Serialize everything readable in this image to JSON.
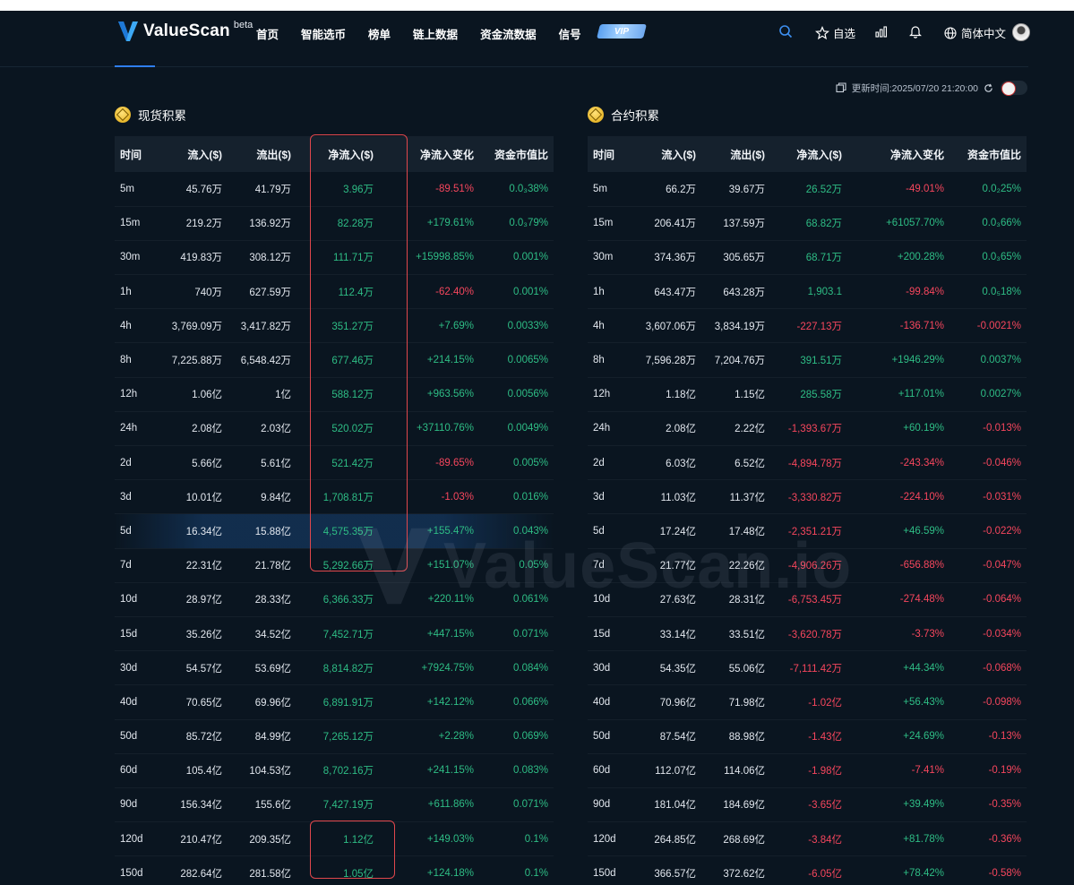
{
  "nav": {
    "logo_text": "ValueScan",
    "logo_beta": "beta",
    "links": [
      "首页",
      "智能选币",
      "榜单",
      "链上数据",
      "资金流数据",
      "信号"
    ],
    "vip_label": "VIP",
    "watchlist_label": "自选",
    "language_label": "简体中文"
  },
  "update_text": "更新时间:2025/07/20 21:20:00",
  "watermark_text": "ValueScan.io",
  "spot": {
    "title": "现货积累",
    "headers": [
      "时间",
      "流入($)",
      "流出($)",
      "净流入($)",
      "净流入变化",
      "资金市值比"
    ],
    "rows": [
      [
        "5m",
        "45.76万",
        "41.79万",
        "3.96万",
        "-89.51%",
        "0.0₃38%"
      ],
      [
        "15m",
        "219.2万",
        "136.92万",
        "82.28万",
        "+179.61%",
        "0.0₃79%"
      ],
      [
        "30m",
        "419.83万",
        "308.12万",
        "111.71万",
        "+15998.85%",
        "0.001%"
      ],
      [
        "1h",
        "740万",
        "627.59万",
        "112.4万",
        "-62.40%",
        "0.001%"
      ],
      [
        "4h",
        "3,769.09万",
        "3,417.82万",
        "351.27万",
        "+7.69%",
        "0.0033%"
      ],
      [
        "8h",
        "7,225.88万",
        "6,548.42万",
        "677.46万",
        "+214.15%",
        "0.0065%"
      ],
      [
        "12h",
        "1.06亿",
        "1亿",
        "588.12万",
        "+963.56%",
        "0.0056%"
      ],
      [
        "24h",
        "2.08亿",
        "2.03亿",
        "520.02万",
        "+37110.76%",
        "0.0049%"
      ],
      [
        "2d",
        "5.66亿",
        "5.61亿",
        "521.42万",
        "-89.65%",
        "0.005%"
      ],
      [
        "3d",
        "10.01亿",
        "9.84亿",
        "1,708.81万",
        "-1.03%",
        "0.016%"
      ],
      [
        "5d",
        "16.34亿",
        "15.88亿",
        "4,575.35万",
        "+155.47%",
        "0.043%"
      ],
      [
        "7d",
        "22.31亿",
        "21.78亿",
        "5,292.66万",
        "+151.07%",
        "0.05%"
      ],
      [
        "10d",
        "28.97亿",
        "28.33亿",
        "6,366.33万",
        "+220.11%",
        "0.061%"
      ],
      [
        "15d",
        "35.26亿",
        "34.52亿",
        "7,452.71万",
        "+447.15%",
        "0.071%"
      ],
      [
        "30d",
        "54.57亿",
        "53.69亿",
        "8,814.82万",
        "+7924.75%",
        "0.084%"
      ],
      [
        "40d",
        "70.65亿",
        "69.96亿",
        "6,891.91万",
        "+142.12%",
        "0.066%"
      ],
      [
        "50d",
        "85.72亿",
        "84.99亿",
        "7,265.12万",
        "+2.28%",
        "0.069%"
      ],
      [
        "60d",
        "105.4亿",
        "104.53亿",
        "8,702.16万",
        "+241.15%",
        "0.083%"
      ],
      [
        "90d",
        "156.34亿",
        "155.6亿",
        "7,427.19万",
        "+611.86%",
        "0.071%"
      ],
      [
        "120d",
        "210.47亿",
        "209.35亿",
        "1.12亿",
        "+149.03%",
        "0.1%"
      ],
      [
        "150d",
        "282.64亿",
        "281.58亿",
        "1.05亿",
        "+124.18%",
        "0.1%"
      ]
    ]
  },
  "futures": {
    "title": "合约积累",
    "headers": [
      "时间",
      "流入($)",
      "流出($)",
      "净流入($)",
      "净流入变化",
      "资金市值比"
    ],
    "rows": [
      [
        "5m",
        "66.2万",
        "39.67万",
        "26.52万",
        "-49.01%",
        "0.0₂25%"
      ],
      [
        "15m",
        "206.41万",
        "137.59万",
        "68.82万",
        "+61057.70%",
        "0.0₃66%"
      ],
      [
        "30m",
        "374.36万",
        "305.65万",
        "68.71万",
        "+200.28%",
        "0.0₃65%"
      ],
      [
        "1h",
        "643.47万",
        "643.28万",
        "1,903.1",
        "-99.84%",
        "0.0₅18%"
      ],
      [
        "4h",
        "3,607.06万",
        "3,834.19万",
        "-227.13万",
        "-136.71%",
        "-0.0021%"
      ],
      [
        "8h",
        "7,596.28万",
        "7,204.76万",
        "391.51万",
        "+1946.29%",
        "0.0037%"
      ],
      [
        "12h",
        "1.18亿",
        "1.15亿",
        "285.58万",
        "+117.01%",
        "0.0027%"
      ],
      [
        "24h",
        "2.08亿",
        "2.22亿",
        "-1,393.67万",
        "+60.19%",
        "-0.013%"
      ],
      [
        "2d",
        "6.03亿",
        "6.52亿",
        "-4,894.78万",
        "-243.34%",
        "-0.046%"
      ],
      [
        "3d",
        "11.03亿",
        "11.37亿",
        "-3,330.82万",
        "-224.10%",
        "-0.031%"
      ],
      [
        "5d",
        "17.24亿",
        "17.48亿",
        "-2,351.21万",
        "+46.59%",
        "-0.022%"
      ],
      [
        "7d",
        "21.77亿",
        "22.26亿",
        "-4,906.26万",
        "-656.88%",
        "-0.047%"
      ],
      [
        "10d",
        "27.63亿",
        "28.31亿",
        "-6,753.45万",
        "-274.48%",
        "-0.064%"
      ],
      [
        "15d",
        "33.14亿",
        "33.51亿",
        "-3,620.78万",
        "-3.73%",
        "-0.034%"
      ],
      [
        "30d",
        "54.35亿",
        "55.06亿",
        "-7,111.42万",
        "+44.34%",
        "-0.068%"
      ],
      [
        "40d",
        "70.96亿",
        "71.98亿",
        "-1.02亿",
        "+56.43%",
        "-0.098%"
      ],
      [
        "50d",
        "87.54亿",
        "88.98亿",
        "-1.43亿",
        "+24.69%",
        "-0.13%"
      ],
      [
        "60d",
        "112.07亿",
        "114.06亿",
        "-1.98亿",
        "-7.41%",
        "-0.19%"
      ],
      [
        "90d",
        "181.04亿",
        "184.69亿",
        "-3.65亿",
        "+39.49%",
        "-0.35%"
      ],
      [
        "120d",
        "264.85亿",
        "268.69亿",
        "-3.84亿",
        "+81.78%",
        "-0.36%"
      ],
      [
        "150d",
        "366.57亿",
        "372.62亿",
        "-6.05亿",
        "+78.42%",
        "-0.58%"
      ]
    ]
  },
  "colors": {
    "green": "#2ebd85",
    "red": "#f6465d",
    "accent": "#2f7ef0",
    "background": "#0a1520"
  }
}
